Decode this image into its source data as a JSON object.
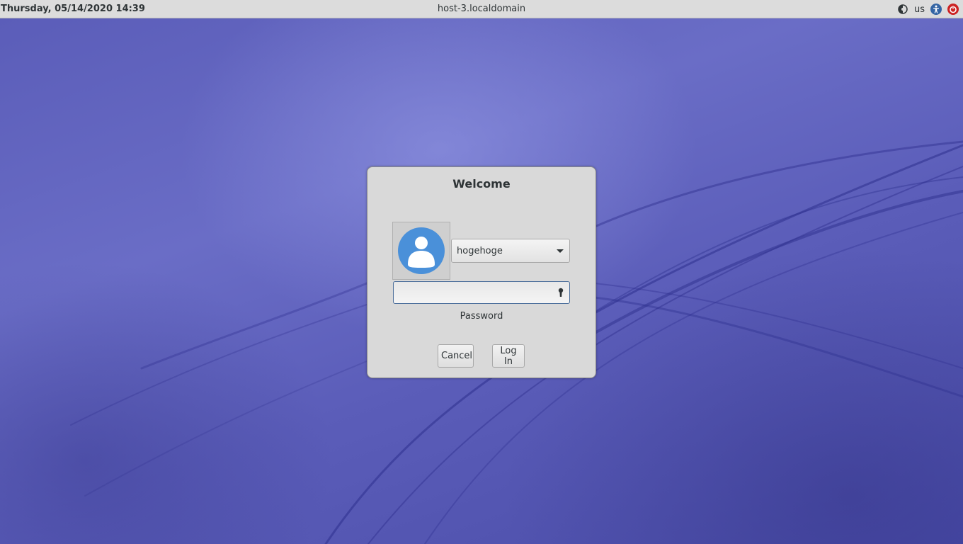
{
  "top_panel": {
    "datetime": "Thursday, 05/14/2020 14:39",
    "hostname": "host-3.localdomain",
    "keyboard_layout": "us",
    "icons": [
      "display-icon",
      "accessibility-icon",
      "power-icon"
    ]
  },
  "login_dialog": {
    "title": "Welcome",
    "user_select": {
      "selected": "hogehoge",
      "icon": "chevron-down-icon"
    },
    "password": {
      "value": "",
      "label": "Password",
      "icon": "keyhole-icon"
    },
    "buttons": {
      "cancel_label": "Cancel",
      "login_label": "Log In"
    }
  },
  "colors": {
    "wallpaper": "#5a5cb8",
    "panel": "#dcdcdc",
    "dialog": "#d9d9d9",
    "avatar": "#4a90d9",
    "power_icon": "#cc2222",
    "accessibility_icon": "#3465a4"
  }
}
